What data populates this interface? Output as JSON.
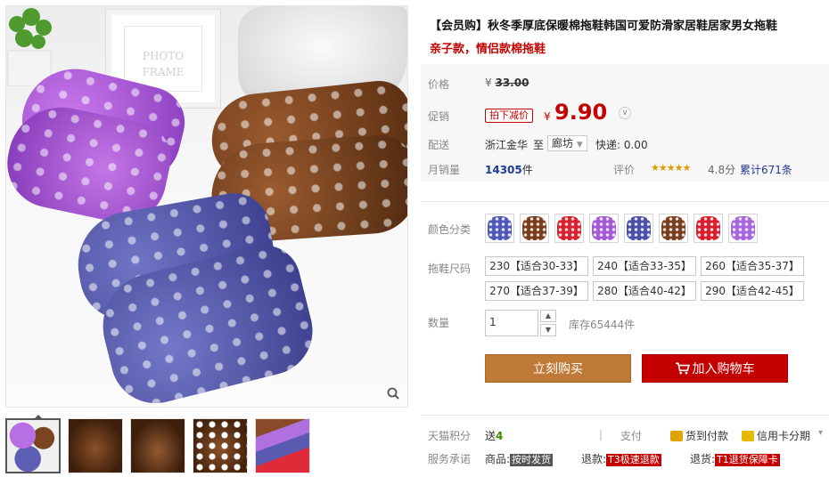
{
  "gallery": {
    "frame_text_line1": "PHOTO",
    "frame_text_line2": "FRAME",
    "zoom_icon": "magnifier-icon",
    "thumbnails": [
      "thumb-1",
      "thumb-2",
      "thumb-3",
      "thumb-4",
      "thumb-5"
    ],
    "active_thumb": 0
  },
  "product": {
    "title": "【会员购】秋冬季厚底保暖棉拖鞋韩国可爱防滑家居鞋居家男女拖鞋",
    "subtitle": "亲子款，情侣款棉拖鞋"
  },
  "price": {
    "label": "价格",
    "currency": "¥",
    "original": "33.00"
  },
  "promo": {
    "label": "促销",
    "tag": "拍下减价",
    "currency": "¥",
    "price": "9.90",
    "toggle_icon": "chevron-down-icon"
  },
  "shipping": {
    "label": "配送",
    "from": "浙江金华",
    "to_word": "至",
    "destination": "廊坊",
    "express": "快递: 0.00"
  },
  "sales": {
    "label": "月销量",
    "count": "14305",
    "unit": "件",
    "rating_label": "评价",
    "stars": "★★★★★",
    "score": "4.8分",
    "reviews": "累计671条"
  },
  "colors": {
    "label": "颜色分类",
    "swatches": [
      "#4f58b8",
      "#7a3d1c",
      "#d8202e",
      "#a45ad8",
      "#4a4fa8",
      "#7a3f1e",
      "#d81e2c",
      "#a866de"
    ]
  },
  "sizes": {
    "label": "拖鞋尺码",
    "options": [
      "230【适合30-33】",
      "240【适合33-35】",
      "260【适合35-37】",
      "270【适合37-39】",
      "280【适合40-42】",
      "290【适合42-45】"
    ]
  },
  "quantity": {
    "label": "数量",
    "value": "1",
    "stock": "库存65444件"
  },
  "actions": {
    "buy_now": "立刻购买",
    "add_to_cart": "加入购物车",
    "cart_icon": "cart-icon"
  },
  "footer": {
    "points_label": "天猫积分",
    "points_text": "送",
    "points_value": "4",
    "pay_label": "支付",
    "cod": "货到付款",
    "credit": "信用卡分期",
    "service_label": "服务承诺",
    "goods_label": "商品:",
    "goods_tag": "按时发货",
    "refund_label": "退款:",
    "refund_tag": "T3极速退款",
    "return_label": "退货:",
    "return_tag": "T1退货保障卡"
  }
}
